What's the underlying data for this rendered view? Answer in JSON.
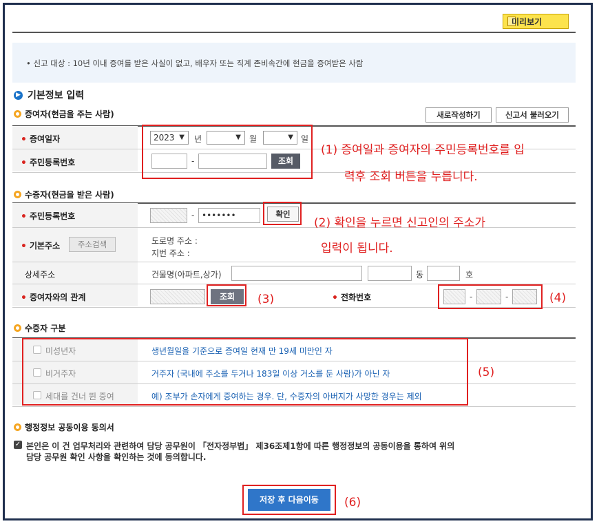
{
  "header": {
    "preview_label": "미리보기",
    "preview_icon": "document-icon"
  },
  "notice": {
    "text": "• 신고 대상 : 10년 이내 증여를 받은 사실이 없고, 배우자 또는 직계 존비속간에 현금을 증여받은 사람"
  },
  "basic_info": {
    "title": "기본정보 입력"
  },
  "donor": {
    "title": "증여자(현금을 주는 사람)",
    "new_button": "새로작성하기",
    "load_button": "신고서 불러오기",
    "date_label": "증여일자",
    "year_value": "2023",
    "year_unit": "년",
    "month_unit": "월",
    "day_unit": "일",
    "rrn_label": "주민등록번호",
    "rrn_dash": "-",
    "lookup_button": "조회"
  },
  "recipient": {
    "title": "수증자(현금을 받은 사람)",
    "rrn_label": "주민등록번호",
    "rrn_dash": "-",
    "rrn_back_masked": "•••••••",
    "confirm_button": "확인",
    "address_label": "기본주소",
    "address_search_button": "주소검색",
    "road_address": "도로명 주소 :",
    "lot_address": "지번 주소 :",
    "detail_label": "상세주소",
    "building_label": "건물명(아파트,상가)",
    "dong_unit": "동",
    "ho_unit": "호",
    "relation_label": "증여자와의 관계",
    "relation_lookup_button": "조회",
    "phone_label": "전화번호",
    "phone_dash": "-"
  },
  "recipient_type": {
    "title": "수증자 구분",
    "rows": [
      {
        "label": "미성년자",
        "desc": "생년월일을 기준으로 증여일 현재 만 19세 미만인 자"
      },
      {
        "label": "비거주자",
        "desc": "거주자 (국내에 주소를 두거나 183일 이상 거소를 둔 사람)가 아닌 자"
      },
      {
        "label": "세대를 건너 뛴 증여",
        "desc": "예) 조부가 손자에게 증여하는 경우. 단, 수증자의 아버지가 사망한 경우는 제외"
      }
    ]
  },
  "consent": {
    "title": "행정정보 공동이용 동의서",
    "line1": "본인은 이 건 업무처리와 관련하여 담당 공무원이 「전자정부법」 제36조제1항에 따른 행정정보의 공동이용을 통하여 위의",
    "line2": "담당 공무원 확인 사항을 확인하는 것에 동의합니다.",
    "checked": true
  },
  "save_button": "저장 후 다음이동",
  "annotations": {
    "a1_line1": "(1) 증여일과 증여자의 주민등록번호를 입",
    "a1_line2": "력후 조회 버튼을 누릅니다.",
    "a2_line1": "(2) 확인을 누르면 신고인의 주소가",
    "a2_line2": "입력이 됩니다.",
    "a3": "(3)",
    "a4": "(4)",
    "a5": "(5)",
    "a6": "(6)"
  },
  "colors": {
    "accent_blue": "#2f76c9",
    "annotation_red": "#e02020",
    "required_red": "#d9241f",
    "preview_yellow": "#fce34d"
  }
}
